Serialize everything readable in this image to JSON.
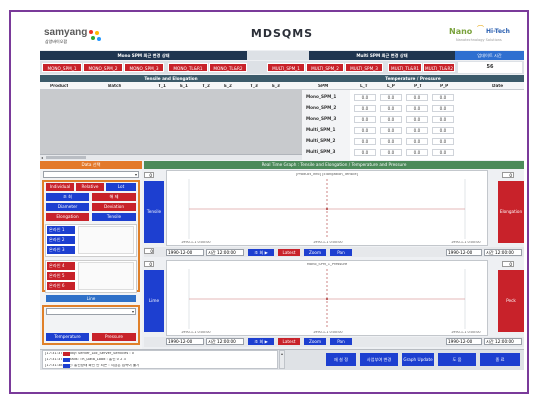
{
  "app": {
    "logo_left": "samyang",
    "logo_left_sub": "삼양바이오팜",
    "title": "MDSQMS",
    "logo_right": "Nano",
    "logo_right_b": "Hi-Tech",
    "logo_right_sub": "Nanotechnology Solutions"
  },
  "top": {
    "mono_header": "Mono SPM 최근 변경 상태",
    "multi_header": "Multi SPM 최근 변경 상태",
    "time_header": "업데이트 시간",
    "time_value": "56",
    "mono_chips": [
      "MONO_SPM_1",
      "MONO_SPM_2",
      "MONO_SPM_3",
      "MONO_TL&R1",
      "MONO_TL&R2"
    ],
    "multi_chips": [
      "MULTI_SPM_1",
      "MULTI_SPM_2",
      "MULTI_SPM_3",
      "MULTI_TL&R1",
      "MULTI_TL&R2"
    ]
  },
  "tensile_table": {
    "title": "Tensile and Elongation",
    "columns": [
      "Product",
      "Batch",
      "T_1",
      "E_1",
      "T_2",
      "E_2",
      "T_3",
      "E_3"
    ]
  },
  "temp_table": {
    "title": "Temperature / Pressure",
    "columns": [
      "SPM",
      "L_T",
      "L_P",
      "P_T",
      "P_P",
      "Date"
    ],
    "rows": [
      {
        "spm": "Mono_SPM_1",
        "lt": "0.0",
        "lp": "0.0",
        "pt": "0.0",
        "pp": "0.0"
      },
      {
        "spm": "Mono_SPM_2",
        "lt": "0.0",
        "lp": "0.0",
        "pt": "0.0",
        "pp": "0.0"
      },
      {
        "spm": "Mono_SPM_3",
        "lt": "0.0",
        "lp": "0.0",
        "pt": "0.0",
        "pp": "0.0"
      },
      {
        "spm": "Multi_SPM_1",
        "lt": "0.0",
        "lp": "0.0",
        "pt": "0.0",
        "pp": "0.0"
      },
      {
        "spm": "Multi_SPM_2",
        "lt": "0.0",
        "lp": "0.0",
        "pt": "0.0",
        "pp": "0.0"
      },
      {
        "spm": "Multi_SPM_3",
        "lt": "0.0",
        "lp": "0.0",
        "pt": "0.0",
        "pp": "0.0"
      }
    ]
  },
  "left_panel": {
    "header": "Data 선택",
    "mode_buttons": [
      "Individual",
      "Relative",
      "Lot"
    ],
    "row2": [
      "조 회",
      "해 제"
    ],
    "row3": [
      "Diameter",
      "Deviation"
    ],
    "row4": [
      "Elongation",
      "Tensile"
    ],
    "checks_a": [
      "온라인 1",
      "온라인 2",
      "온라인 3"
    ],
    "checks_b": [
      "온라인 4",
      "온라인 5",
      "온라인 6"
    ],
    "line_button": "Line",
    "bottom_buttons": [
      "Temperature",
      "Pressure"
    ]
  },
  "graph": {
    "header": "Real Time Graph : Tensile and Elongation / Temperature and Pressure",
    "top_title": "[Product_Info] [Elongation_Tensile]",
    "bottom_title": "Mono_SPM_1_Pressure",
    "left_btn_top": "Tensile",
    "right_btn_top": "Elongation",
    "left_btn_bottom": "Lime",
    "right_btn_bottom": "Peck",
    "spin_top_left": "0",
    "spin_top_right": "0",
    "spin_bottom_left": "0",
    "spin_bottom_right": "0",
    "axis_labels_top": [
      "1990-1-1 0:00:00",
      "1990-1-1 0:00:00",
      "1990-1-1 0:00:00"
    ],
    "axis_labels_bottom": [
      "1990-1-1 0:00:00",
      "1990-1-1 0:00:00",
      "1990-1-1 0:00:00"
    ],
    "time_left": "1990-12-00",
    "time_left2": "시간 12:00:00",
    "time_right": "1990-12-00",
    "time_right2": "시간 12:00:00",
    "ctrl_buttons": [
      "조 회 ▶",
      "Latest",
      "Zoom",
      "Pan"
    ]
  },
  "footer": {
    "log": [
      "[17:31:37] Lobby: Server_Loc_Server_Services : 0",
      "[17:31:37] Details: TR_Data_Load : 통신 0 2 3",
      "[17:31:38] 통신: 통신상태 확인 안 되는 : 지금은 접속이 불가"
    ],
    "buttons": [
      "재 설 정",
      "사업부여 변경",
      "Graph Update",
      "도 움",
      "종 료"
    ]
  }
}
